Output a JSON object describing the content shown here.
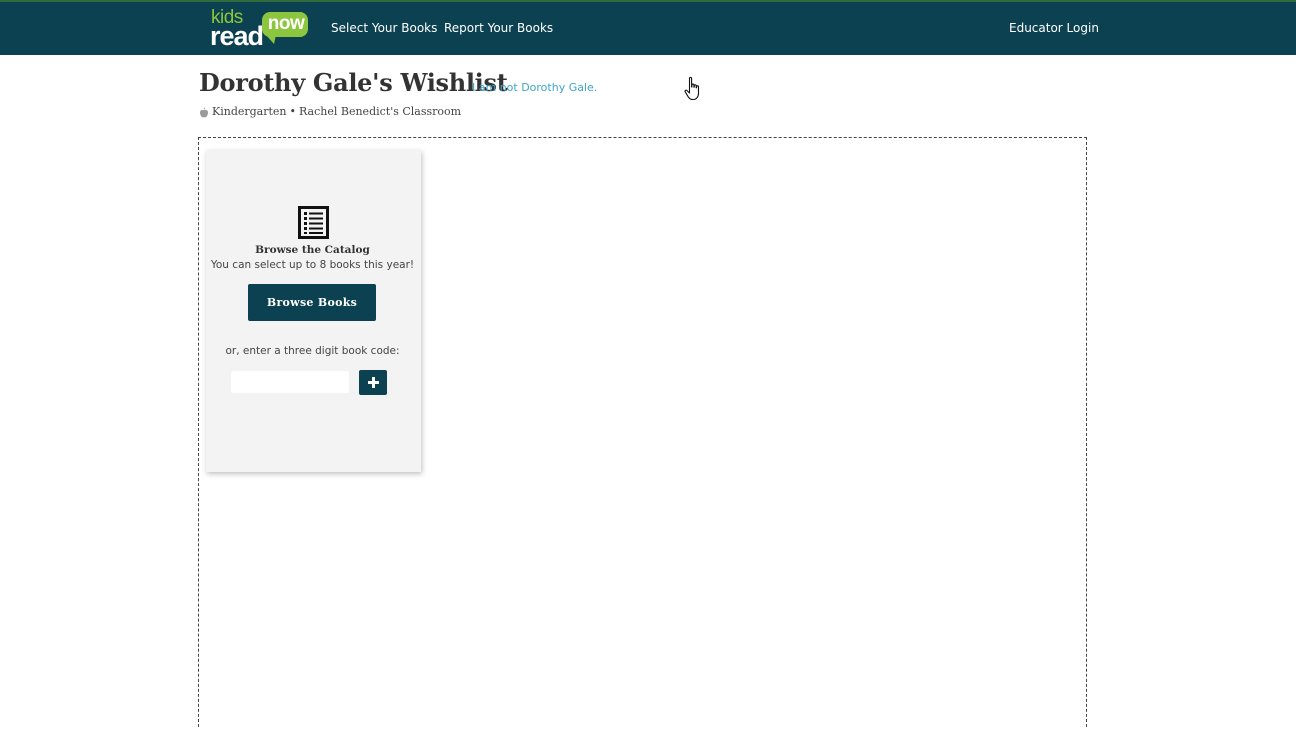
{
  "navbar": {
    "logo": {
      "kids": "kids",
      "read": "read",
      "now": "now"
    },
    "links": {
      "select_books": "Select Your Books",
      "report_books": "Report Your Books",
      "educator_login": "Educator Login"
    }
  },
  "header": {
    "title": "Dorothy Gale's Wishlist",
    "not_me_link": "I am not Dorothy Gale.",
    "grade": "Kindergarten",
    "separator": "•",
    "classroom": "Rachel Benedict's Classroom"
  },
  "browse_card": {
    "heading": "Browse the Catalog",
    "text": "You can select up to 8 books this year!",
    "button_label": "Browse Books",
    "code_prompt": "or, enter a three digit book code:",
    "code_input_value": "",
    "code_input_placeholder": ""
  },
  "icons": {
    "apple": "apple-icon",
    "catalog": "list-document-icon",
    "add": "plus-icon",
    "cursor": "hand-pointer-icon"
  },
  "colors": {
    "navbar_bg": "#0b4150",
    "logo_green": "#8cc63f",
    "link_blue": "#3ca6c7",
    "button_bg": "#0b4150",
    "card_bg": "#f3f3f3"
  }
}
